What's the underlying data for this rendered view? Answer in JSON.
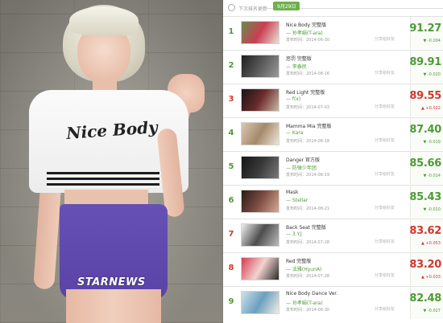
{
  "photo": {
    "watermark": "STARNEWS",
    "shirt_text": "Nice Body"
  },
  "chart": {
    "update_label": "下次排名更新",
    "time_tag": "9月29日",
    "share_label": "分享给好友",
    "release_prefix": "发布时间：",
    "rows": [
      {
        "rank": "1",
        "rank_color": "green",
        "song": "Nice Body 完整版",
        "artist": "— 孙孝娟(T-ara)",
        "release": "发布时间：2014-06-30",
        "score": "91.27",
        "score_color": "green",
        "delta": "▼ -0.004",
        "delta_dir": "down",
        "thumb_colors": [
          "#6a8a4e",
          "#c93f52",
          "#e9e2d7"
        ]
      },
      {
        "rank": "2",
        "rank_color": "green",
        "song": "惩罚 完整版",
        "artist": "— 李泰民",
        "release": "发布时间：2014-08-16",
        "score": "89.91",
        "score_color": "green",
        "delta": "▼ -0.020",
        "delta_dir": "down",
        "thumb_colors": [
          "#1e1e1e",
          "#5a5a5a",
          "#9a9a9a"
        ]
      },
      {
        "rank": "3",
        "rank_color": "red",
        "song": "Red Light 完整版",
        "artist": "— f(x)",
        "release": "发布时间：2014-07-03",
        "score": "89.55",
        "score_color": "red",
        "delta": "▲ +0.022",
        "delta_dir": "up",
        "thumb_colors": [
          "#1a1414",
          "#6b2b2b",
          "#c9b8a6"
        ]
      },
      {
        "rank": "4",
        "rank_color": "green",
        "song": "Mamma Mia 完整版",
        "artist": "— Kara",
        "release": "发布时间：2014-08-18",
        "score": "87.40",
        "score_color": "green",
        "delta": "▼ -0.019",
        "delta_dir": "down",
        "thumb_colors": [
          "#d9c8b2",
          "#a58a6b",
          "#efe6d9"
        ]
      },
      {
        "rank": "5",
        "rank_color": "green",
        "song": "Danger 官方版",
        "artist": "— 防弹少年团",
        "release": "发布时间：2014-08-19",
        "score": "85.66",
        "score_color": "green",
        "delta": "▼ -0.014",
        "delta_dir": "down",
        "thumb_colors": [
          "#141414",
          "#3a3a3a",
          "#7a7a7a"
        ]
      },
      {
        "rank": "6",
        "rank_color": "green",
        "song": "Mask",
        "artist": "— Stellar",
        "release": "发布时间：2014-08-21",
        "score": "85.43",
        "score_color": "green",
        "delta": "▼ -0.010",
        "delta_dir": "down",
        "thumb_colors": [
          "#2a1a18",
          "#7d4d42",
          "#d8a995"
        ]
      },
      {
        "rank": "7",
        "rank_color": "red",
        "song": "Back Seat 完整版",
        "artist": "— 3.Y.J",
        "release": "发布时间：2014-07-28",
        "score": "83.62",
        "score_color": "red",
        "delta": "▲ +0.053",
        "delta_dir": "up",
        "thumb_colors": [
          "#f0f0f0",
          "#4d4d4d",
          "#bcbcbc"
        ]
      },
      {
        "rank": "8",
        "rank_color": "red",
        "song": "Red 完整版",
        "artist": "— 泫雅(HyunA)",
        "release": "发布时间：2014-07-28",
        "score": "83.20",
        "score_color": "red",
        "delta": "▲ +0.033",
        "delta_dir": "up",
        "thumb_colors": [
          "#d63a52",
          "#f2d4cf",
          "#2b2b2b"
        ]
      },
      {
        "rank": "9",
        "rank_color": "green",
        "song": "Nice Body Dance Ver.",
        "artist": "— 孙孝娟(T-ara)",
        "release": "发布时间：2014-06-30",
        "score": "82.48",
        "score_color": "green",
        "delta": "▼ -0.027",
        "delta_dir": "down",
        "thumb_colors": [
          "#cfe1ea",
          "#6aa0be",
          "#f3ede2"
        ]
      }
    ]
  }
}
